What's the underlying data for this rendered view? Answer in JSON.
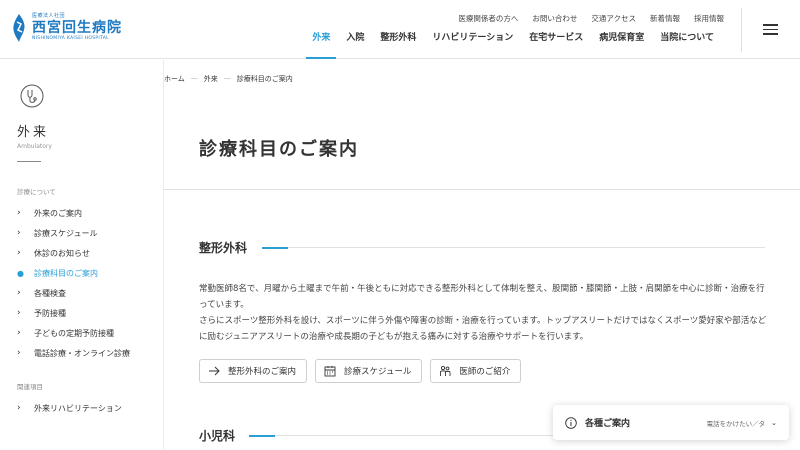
{
  "logo": {
    "sub": "医療法人社団",
    "name": "西宮回生病院",
    "en": "NISHINOMIYA KAISEI HOSPITAL"
  },
  "util_nav": [
    "医療関係者の方へ",
    "お問い合わせ",
    "交通アクセス",
    "新着情報",
    "採用情報"
  ],
  "main_nav": [
    "外来",
    "入院",
    "整形外科",
    "リハビリテーション",
    "在宅サービス",
    "病児保育室",
    "当院について"
  ],
  "sidebar": {
    "title": "外来",
    "subtitle": "Ambulatory",
    "section1": "診療について",
    "items": [
      "外来のご案内",
      "診療スケジュール",
      "休診のお知らせ",
      "診療科目のご案内",
      "各種検査",
      "予防接種",
      "子どもの定期予防接種",
      "電話診療・オンライン診療"
    ],
    "section2": "関連項目",
    "related": [
      "外来リハビリテーション"
    ]
  },
  "breadcrumb": [
    "ホーム",
    "外来",
    "診療科目のご案内"
  ],
  "breadcrumb_sep": "—",
  "page_title": "診療科目のご案内",
  "sections": {
    "ortho": {
      "heading": "整形外科",
      "para1": "常勤医師8名で、月曜から土曜まで午前・午後ともに対応できる整形外科として体制を整え、股関節・膝関節・上肢・肩関節を中心に診断・治療を行っています。",
      "para2": "さらにスポーツ整形外科を設け、スポーツに伴う外傷や障害の診断・治療を行っています。トップアスリートだけではなくスポーツ愛好家や部活などに励むジュニアアスリートの治療や成長期の子どもが抱える痛みに対する治療やサポートを行います。",
      "buttons": [
        "整形外科のご案内",
        "診療スケジュール",
        "医師のご紹介"
      ]
    },
    "pediatrics": {
      "heading": "小児科"
    }
  },
  "float_bar": {
    "title": "各種ご案内",
    "hint": "電話をかけたい／タ"
  },
  "colors": {
    "accent": "#2a9fd6",
    "logo": "#1f7ac2"
  }
}
